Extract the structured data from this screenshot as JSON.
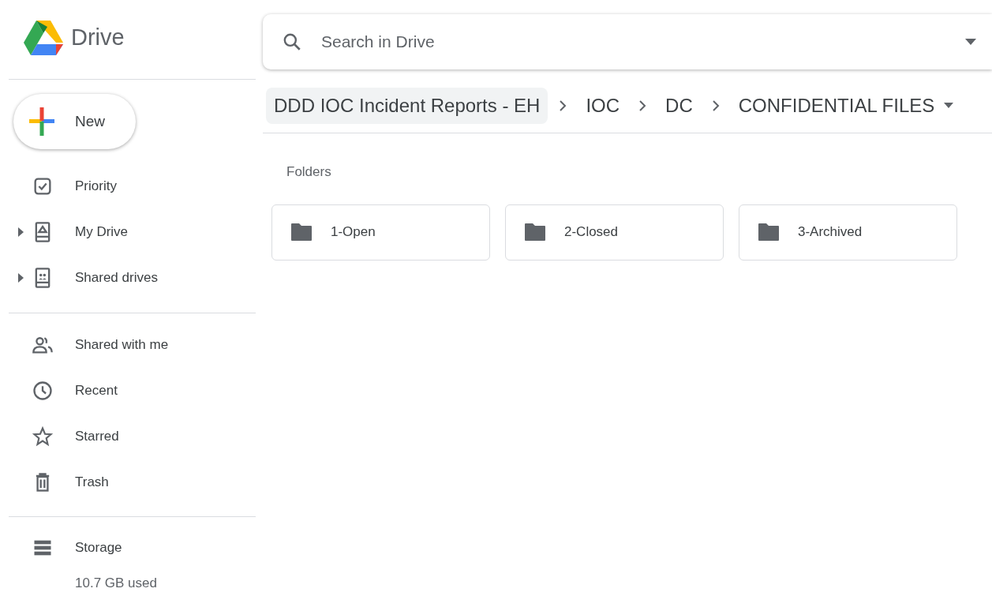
{
  "app": {
    "title": "Drive"
  },
  "search": {
    "placeholder": "Search in Drive"
  },
  "new_button": {
    "label": "New"
  },
  "sidebar": {
    "groups": [
      [
        {
          "label": "Priority",
          "expandable": false
        },
        {
          "label": "My Drive",
          "expandable": true
        },
        {
          "label": "Shared drives",
          "expandable": true
        }
      ],
      [
        {
          "label": "Shared with me",
          "expandable": false
        },
        {
          "label": "Recent",
          "expandable": false
        },
        {
          "label": "Starred",
          "expandable": false
        },
        {
          "label": "Trash",
          "expandable": false
        }
      ],
      [
        {
          "label": "Storage",
          "expandable": false
        }
      ]
    ],
    "storage_used": "10.7 GB used"
  },
  "breadcrumb": [
    {
      "label": "DDD IOC Incident Reports - EH",
      "highlighted": true
    },
    {
      "label": "IOC",
      "highlighted": false
    },
    {
      "label": "DC",
      "highlighted": false
    },
    {
      "label": "CONFIDENTIAL FILES",
      "highlighted": false
    }
  ],
  "folders": {
    "heading": "Folders",
    "items": [
      {
        "name": "1-Open"
      },
      {
        "name": "2-Closed"
      },
      {
        "name": "3-Archived"
      }
    ]
  }
}
